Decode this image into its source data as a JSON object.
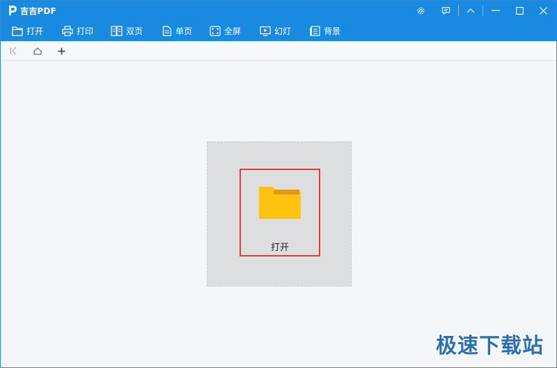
{
  "app": {
    "title": "吉吉PDF",
    "accent_color": "#1a8ae0"
  },
  "titlebar": {
    "controls": [
      "gear-icon",
      "feedback-icon",
      "collapse-icon",
      "minimize-icon",
      "maximize-icon",
      "close-icon"
    ]
  },
  "toolbar": {
    "items": [
      {
        "label": "打开",
        "icon": "open-file-icon"
      },
      {
        "label": "打印",
        "icon": "printer-icon"
      },
      {
        "label": "双页",
        "icon": "two-page-icon"
      },
      {
        "label": "单页",
        "icon": "single-page-icon"
      },
      {
        "label": "全屏",
        "icon": "fullscreen-icon"
      },
      {
        "label": "幻灯",
        "icon": "slideshow-icon"
      },
      {
        "label": "背景",
        "icon": "background-icon"
      }
    ]
  },
  "tabstrip": {
    "buttons": [
      "back-icon",
      "home-icon",
      "add-tab-icon"
    ]
  },
  "main": {
    "open_label": "打开",
    "highlight_color": "#e03a3a",
    "folder_color": "#ffc20e"
  },
  "watermark": {
    "text": "极速下载站"
  }
}
